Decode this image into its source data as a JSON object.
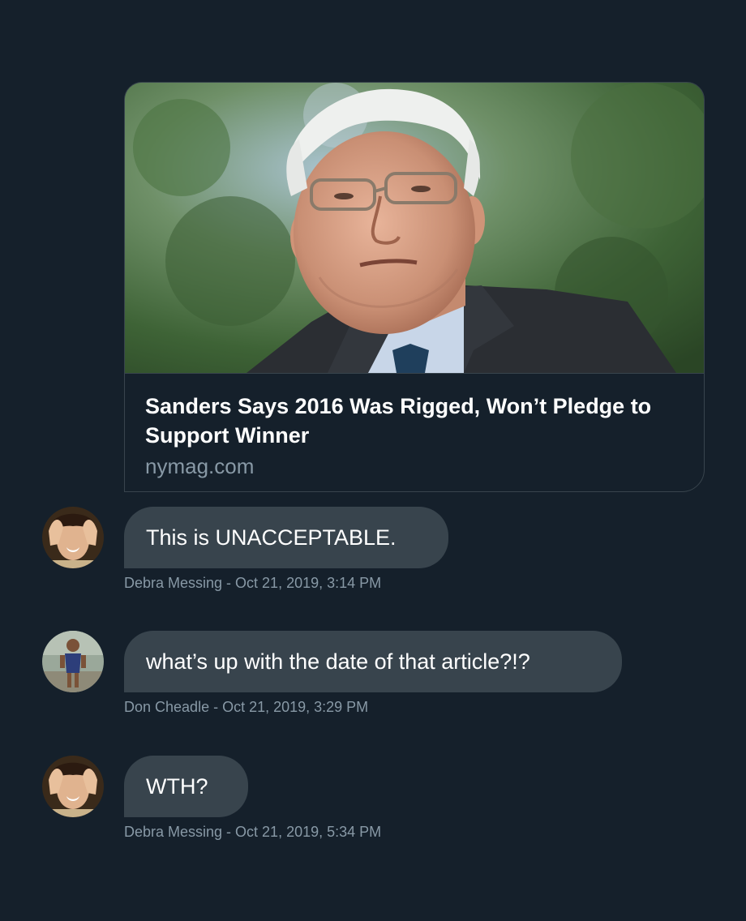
{
  "link_card": {
    "title": "Sanders Says 2016 Was Rigged, Won’t Pledge to Support Winner",
    "domain": "nymag.com",
    "image_alt": "photo of Bernie Sanders"
  },
  "messages": [
    {
      "text": "This is UNACCEPTABLE.",
      "meta": "Debra Messing - Oct 21, 2019, 3:14 PM",
      "avatar": "debra-messing-avatar"
    },
    {
      "text": "what’s up with the date of that article?!?",
      "meta": "Don Cheadle - Oct 21, 2019, 3:29 PM",
      "avatar": "don-cheadle-avatar"
    },
    {
      "text": "WTH?",
      "meta": "Debra Messing - Oct 21, 2019, 5:34 PM",
      "avatar": "debra-messing-avatar"
    }
  ],
  "colors": {
    "background": "#15202b",
    "bubble": "#38444d",
    "meta_text": "#8899a6",
    "border": "#38444d"
  }
}
